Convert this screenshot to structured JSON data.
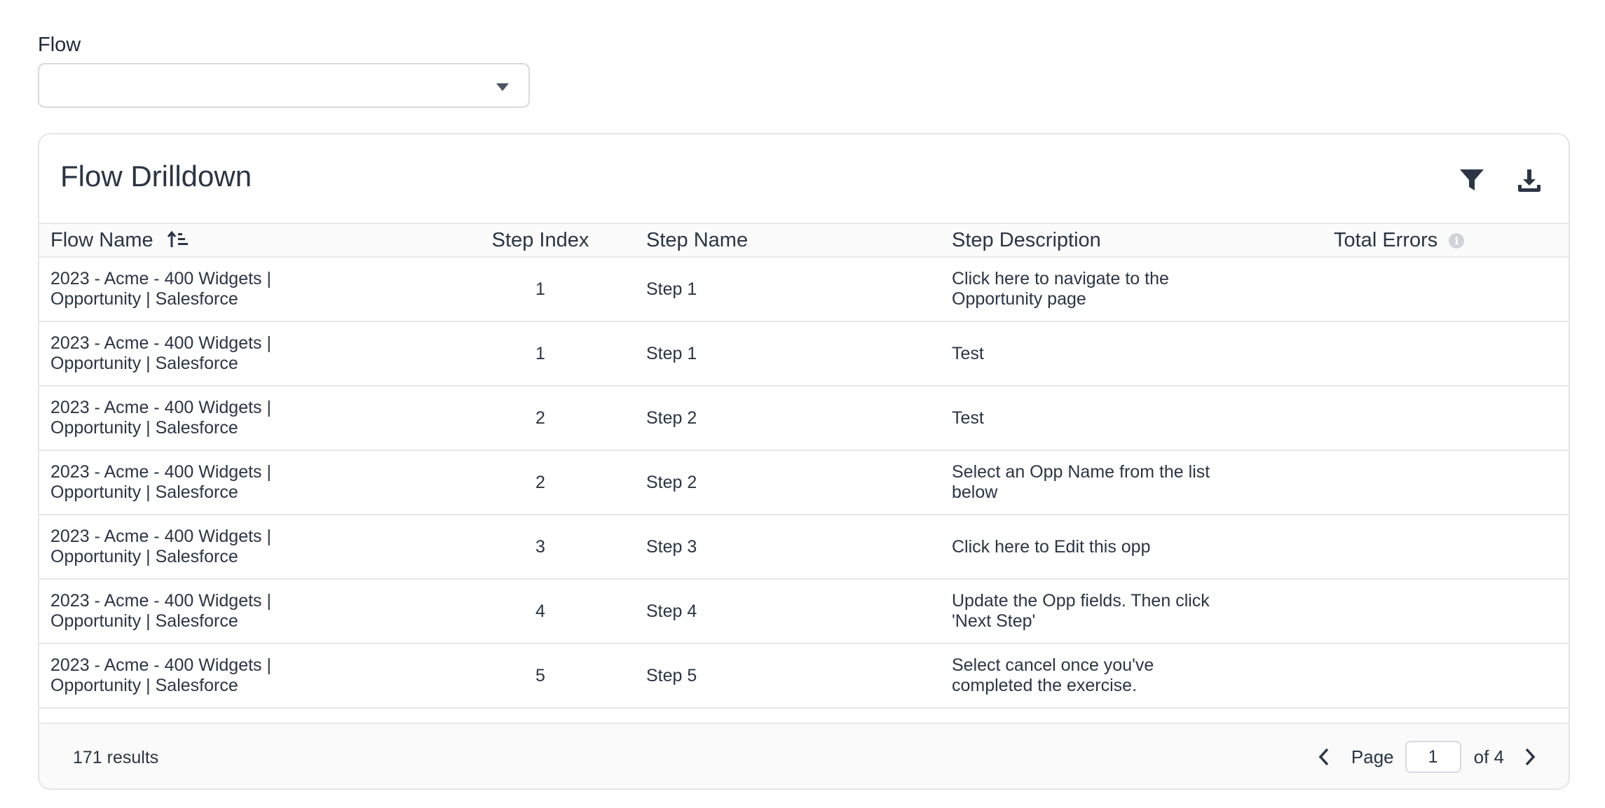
{
  "filter": {
    "label": "Flow",
    "value": ""
  },
  "card": {
    "title": "Flow Drilldown",
    "tools": [
      "filter-icon",
      "download-icon"
    ]
  },
  "table": {
    "columns": [
      "Flow Name",
      "Step Index",
      "Step Name",
      "Step Description",
      "Total Errors"
    ],
    "rows": [
      {
        "flow_name": "2023 - Acme - 400 Widgets | Opportunity | Salesforce",
        "step_index": "1",
        "step_name": "Step 1",
        "step_description": "Click here to navigate to the Opportunity page",
        "total_errors": ""
      },
      {
        "flow_name": "2023 - Acme - 400 Widgets | Opportunity | Salesforce",
        "step_index": "1",
        "step_name": "Step 1",
        "step_description": "Test",
        "total_errors": ""
      },
      {
        "flow_name": "2023 - Acme - 400 Widgets | Opportunity | Salesforce",
        "step_index": "2",
        "step_name": "Step 2",
        "step_description": "Test",
        "total_errors": ""
      },
      {
        "flow_name": "2023 - Acme - 400 Widgets | Opportunity | Salesforce",
        "step_index": "2",
        "step_name": "Step 2",
        "step_description": "Select an Opp Name from the list below",
        "total_errors": ""
      },
      {
        "flow_name": "2023 - Acme - 400 Widgets | Opportunity | Salesforce",
        "step_index": "3",
        "step_name": "Step 3",
        "step_description": "Click here to Edit this opp",
        "total_errors": ""
      },
      {
        "flow_name": "2023 - Acme - 400 Widgets | Opportunity | Salesforce",
        "step_index": "4",
        "step_name": "Step 4",
        "step_description": "Update the Opp fields. Then click 'Next Step'",
        "total_errors": ""
      },
      {
        "flow_name": "2023 - Acme - 400 Widgets | Opportunity | Salesforce",
        "step_index": "5",
        "step_name": "Step 5",
        "step_description": "Select cancel once you've completed the exercise.",
        "total_errors": ""
      }
    ]
  },
  "footer": {
    "results": "171 results",
    "page_label": "Page",
    "page_value": "1",
    "of_label": "of 4"
  }
}
